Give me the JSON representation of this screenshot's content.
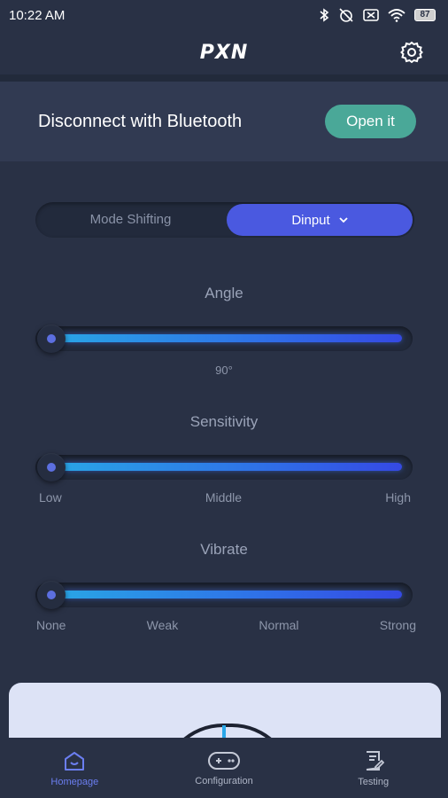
{
  "status_bar": {
    "time": "10:22 AM",
    "battery": "87"
  },
  "header": {
    "logo": "PXN"
  },
  "bluetooth": {
    "text": "Disconnect with Bluetooth",
    "button_label": "Open it"
  },
  "mode": {
    "label": "Mode Shifting",
    "selected": "Dinput"
  },
  "angle": {
    "title": "Angle",
    "value_label": "90°",
    "level": 0
  },
  "sensitivity": {
    "title": "Sensitivity",
    "level": 0,
    "ticks": [
      "Low",
      "Middle",
      "High"
    ]
  },
  "vibrate": {
    "title": "Vibrate",
    "level": 0,
    "ticks": [
      "None",
      "Weak",
      "Normal",
      "Strong"
    ]
  },
  "nav": {
    "items": [
      {
        "label": "Homepage",
        "icon": "home-icon",
        "active": true
      },
      {
        "label": "Configuration",
        "icon": "gamepad-icon",
        "active": false
      },
      {
        "label": "Testing",
        "icon": "document-edit-icon",
        "active": false
      }
    ]
  },
  "colors": {
    "accent": "#4a59e0",
    "open_button": "#4aa898",
    "background": "#293145"
  }
}
